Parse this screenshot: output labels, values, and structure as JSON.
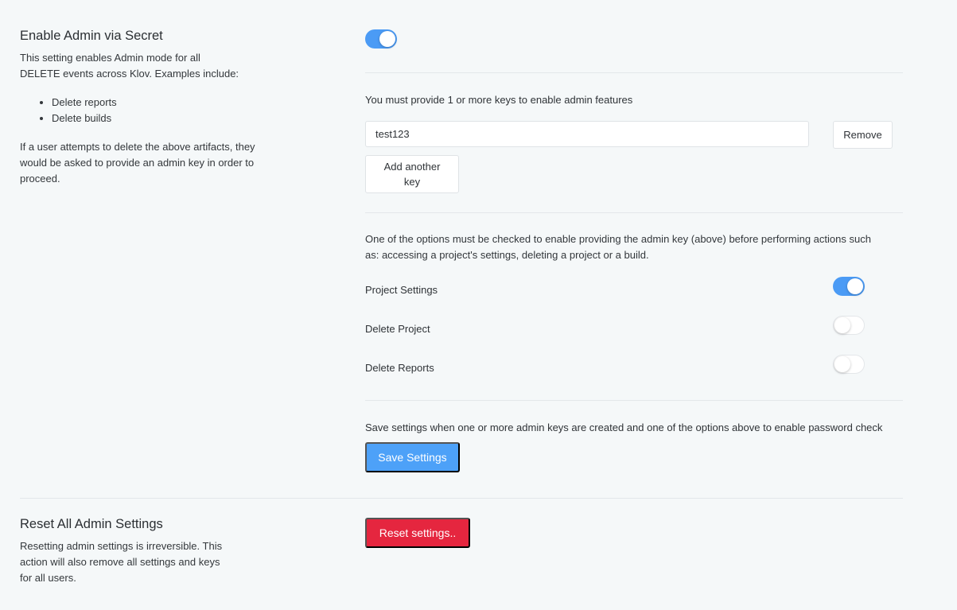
{
  "admin_secret": {
    "title": "Enable Admin via Secret",
    "desc_line1": "This setting enables Admin mode for all",
    "desc_line2": "DELETE events across Klov. Examples include:",
    "examples": [
      "Delete reports",
      "Delete builds"
    ],
    "note_line1": "If a user attempts to delete the above artifacts, they",
    "note_line2": "would be asked to provide an admin key in order to",
    "note_line3": "proceed.",
    "enabled": true
  },
  "keys": {
    "instruction": "You must provide 1 or more keys to enable admin features",
    "items": [
      {
        "value": "test123",
        "remove_label": "Remove"
      }
    ],
    "add_label_line1": "Add another",
    "add_label_line2": "key"
  },
  "options": {
    "description_line1": "One of the options must be checked to enable providing the admin key (above) before performing actions such",
    "description_line2": "as: accessing a project's settings, deleting a project or a build.",
    "items": [
      {
        "label": "Project Settings",
        "checked": true
      },
      {
        "label": "Delete Project",
        "checked": false
      },
      {
        "label": "Delete Reports",
        "checked": false
      }
    ]
  },
  "save": {
    "instruction": "Save settings when one or more admin keys are created and one of the options above to enable password check",
    "button_label": "Save Settings"
  },
  "reset": {
    "title": "Reset All Admin Settings",
    "desc_line1": "Resetting admin settings is irreversible. This",
    "desc_line2": "action will also remove all settings and keys",
    "desc_line3": "for all users.",
    "button_label": "Reset settings.."
  },
  "colors": {
    "toggle_on": "#4b9bf5",
    "primary": "#4da1f8",
    "danger": "#e5263f",
    "background": "#f5f8f9"
  }
}
